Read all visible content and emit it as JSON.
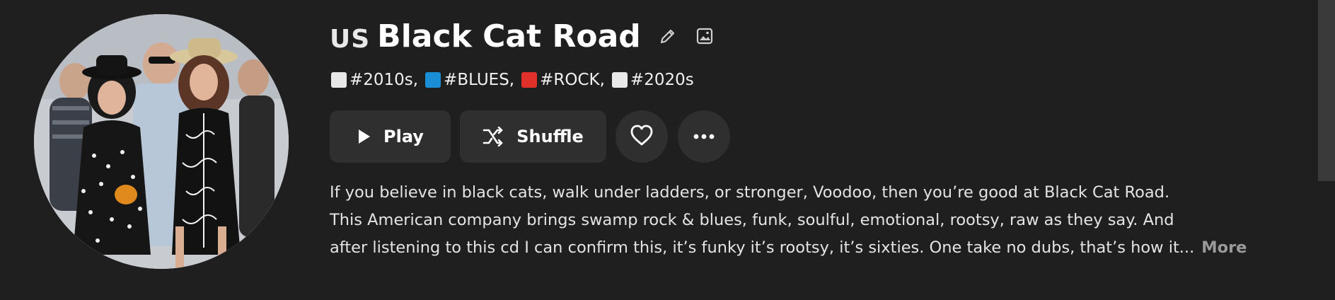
{
  "artist": {
    "country_code": "US",
    "name": "Black Cat Road",
    "edit_icon": "pencil-icon",
    "image_icon": "image-icon",
    "avatar_alt": "artist photo"
  },
  "tags": [
    {
      "label": "#2010s,",
      "color": "#e8e8e8"
    },
    {
      "label": "#BLUES,",
      "color": "#1a8fd6"
    },
    {
      "label": "#ROCK,",
      "color": "#e0302a"
    },
    {
      "label": "#2020s",
      "color": "#e8e8e8"
    }
  ],
  "actions": {
    "play_label": "Play",
    "play_icon": "play-icon",
    "shuffle_label": "Shuffle",
    "shuffle_icon": "shuffle-icon",
    "favorite_icon": "heart-icon",
    "more_icon": "more-options-icon"
  },
  "description": {
    "lines": [
      "If you believe in black cats, walk under ladders, or stronger, Voodoo, then you’re good at Black Cat Road.",
      "This American company brings swamp rock & blues, funk, soulful, emotional, rootsy, raw as they say. And",
      "after listening to this cd I can confirm this, it’s funky it’s rootsy, it’s sixties. One take no dubs, that’s how it..."
    ],
    "more_label": "More"
  },
  "colors": {
    "background": "#1f1f1f",
    "button_bg": "#2f2f2f",
    "text": "#ffffff",
    "muted": "#9a9a9a"
  }
}
